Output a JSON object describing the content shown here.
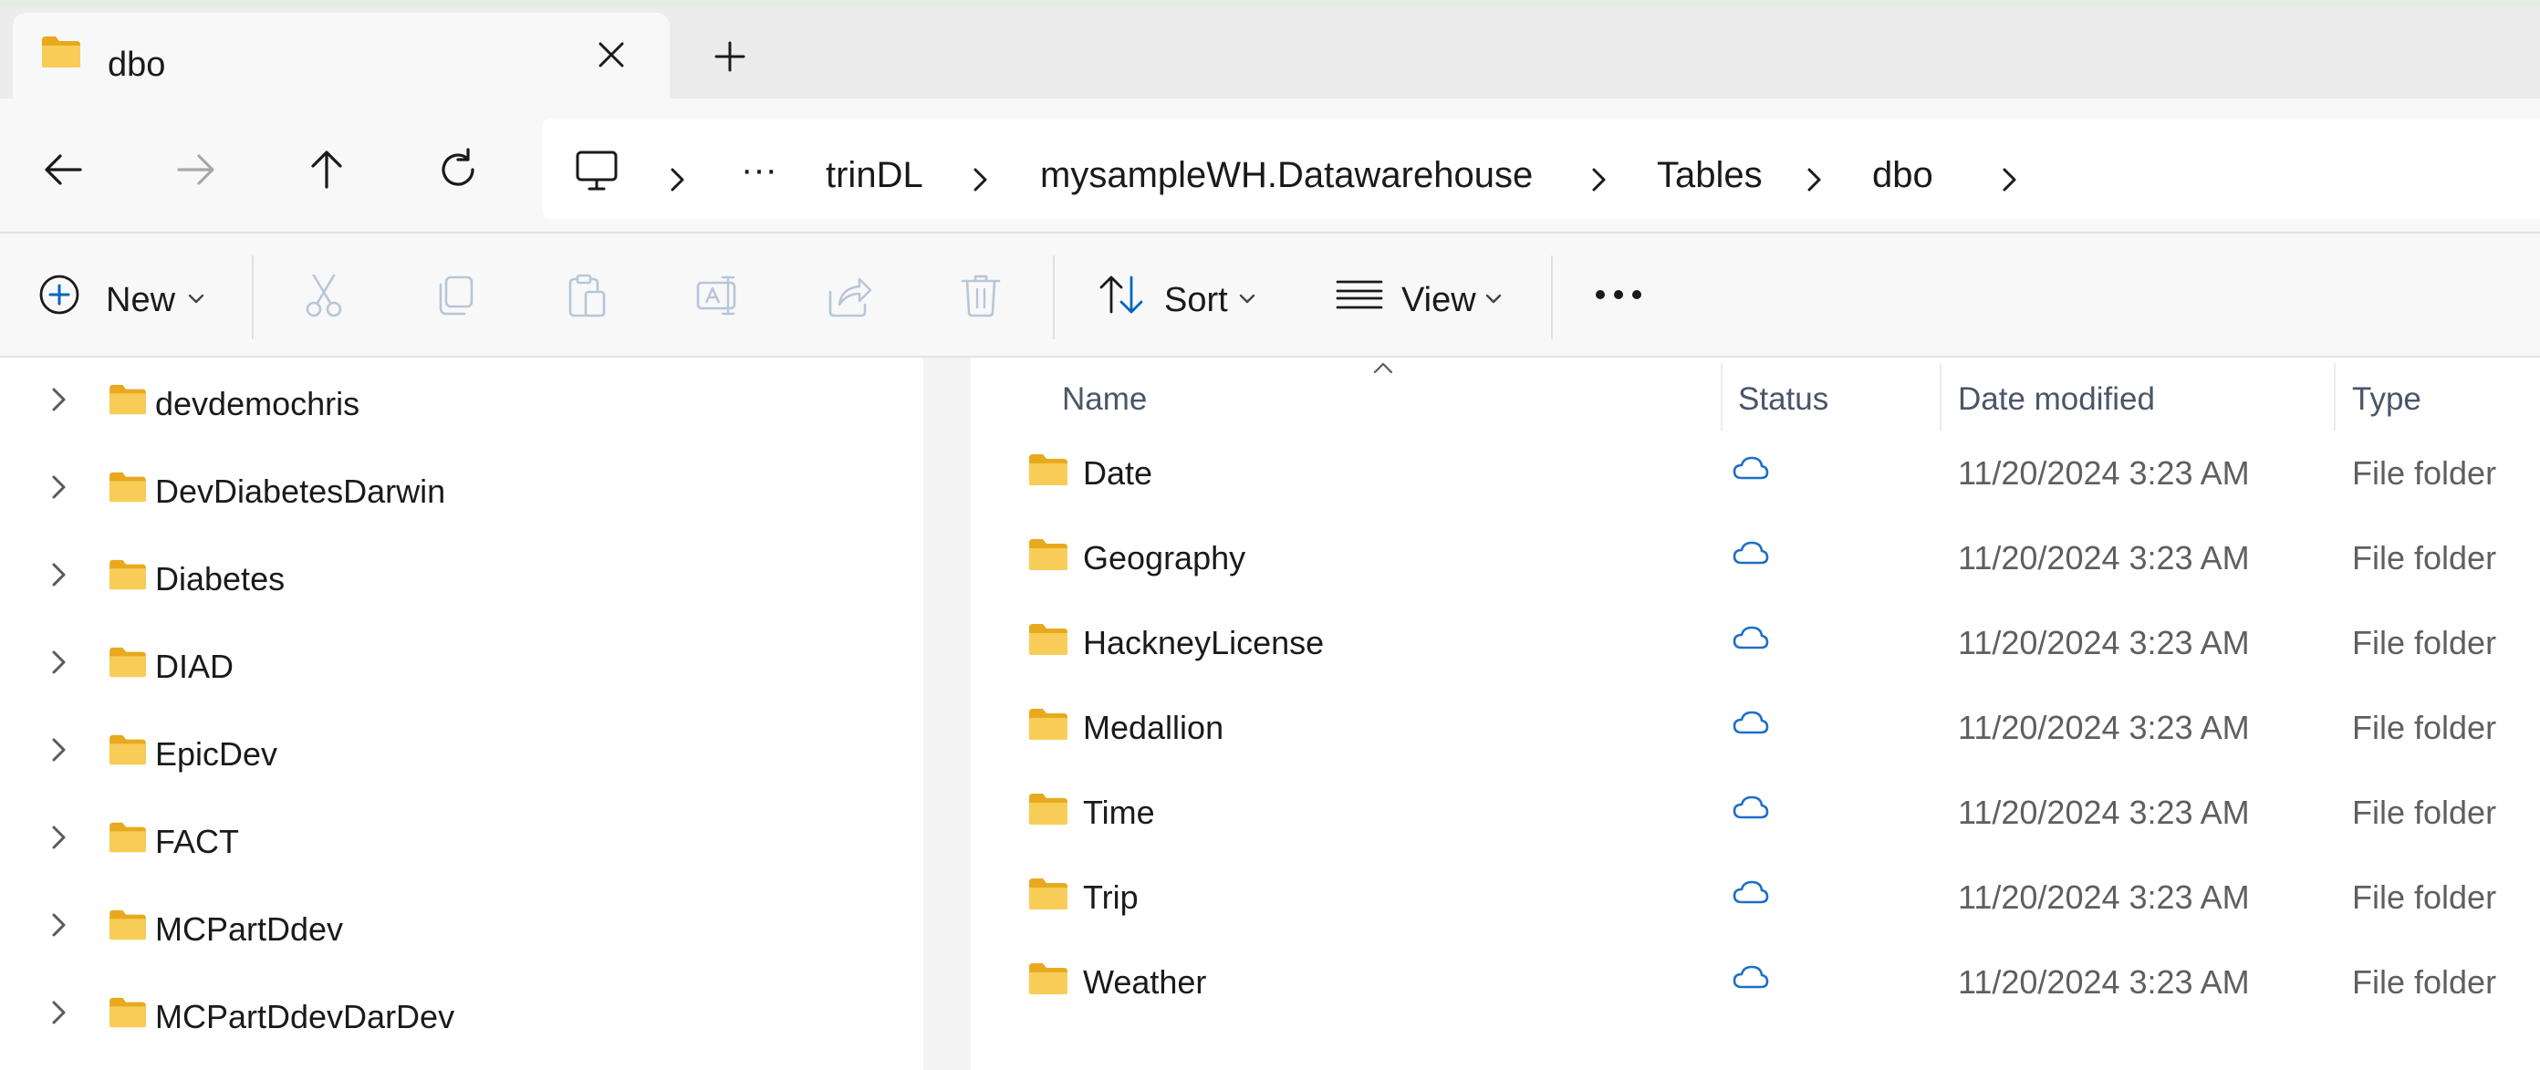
{
  "tab": {
    "title": "dbo",
    "close_icon": "close-icon",
    "new_tab_icon": "plus-icon"
  },
  "nav": {
    "icons": [
      "back-arrow-icon",
      "forward-arrow-icon",
      "up-arrow-icon",
      "refresh-icon"
    ],
    "breadcrumb": {
      "root_icon": "this-pc-icon",
      "overflow": "···",
      "items": [
        "trinDL",
        "mysampleWH.Datawarehouse",
        "Tables",
        "dbo"
      ]
    }
  },
  "toolbar": {
    "new_label": "New",
    "sort_label": "Sort",
    "view_label": "View",
    "icons": [
      "cut-icon",
      "copy-icon",
      "paste-icon",
      "rename-icon",
      "share-icon",
      "delete-icon"
    ],
    "more_icon": "more-options-icon"
  },
  "tree": [
    {
      "label": "devdemochris"
    },
    {
      "label": "DevDiabetesDarwin"
    },
    {
      "label": "Diabetes"
    },
    {
      "label": "DIAD"
    },
    {
      "label": "EpicDev"
    },
    {
      "label": "FACT"
    },
    {
      "label": "MCPartDdev"
    },
    {
      "label": "MCPartDdevDarDev"
    }
  ],
  "columns": {
    "name": "Name",
    "status": "Status",
    "date_modified": "Date modified",
    "type": "Type"
  },
  "files": [
    {
      "name": "Date",
      "status_icon": "cloud-icon",
      "date": "11/20/2024 3:23 AM",
      "type": "File folder"
    },
    {
      "name": "Geography",
      "status_icon": "cloud-icon",
      "date": "11/20/2024 3:23 AM",
      "type": "File folder"
    },
    {
      "name": "HackneyLicense",
      "status_icon": "cloud-icon",
      "date": "11/20/2024 3:23 AM",
      "type": "File folder"
    },
    {
      "name": "Medallion",
      "status_icon": "cloud-icon",
      "date": "11/20/2024 3:23 AM",
      "type": "File folder"
    },
    {
      "name": "Time",
      "status_icon": "cloud-icon",
      "date": "11/20/2024 3:23 AM",
      "type": "File folder"
    },
    {
      "name": "Trip",
      "status_icon": "cloud-icon",
      "date": "11/20/2024 3:23 AM",
      "type": "File folder"
    },
    {
      "name": "Weather",
      "status_icon": "cloud-icon",
      "date": "11/20/2024 3:23 AM",
      "type": "File folder"
    }
  ],
  "colors": {
    "folder": "#f5c84c",
    "cloud": "#1f6fc5",
    "accent": "#0067c0"
  }
}
